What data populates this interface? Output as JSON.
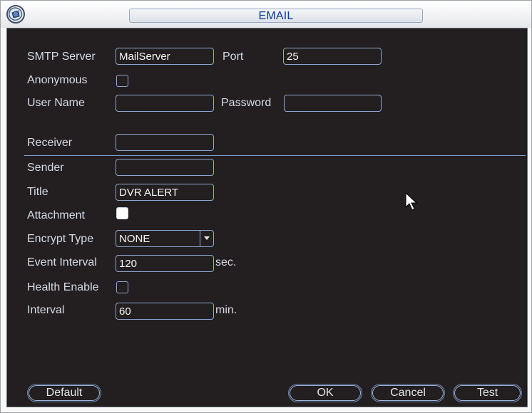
{
  "window": {
    "title": "EMAIL"
  },
  "form": {
    "smtp_server_label": "SMTP Server",
    "smtp_server_value": "MailServer",
    "port_label": "Port",
    "port_value": "25",
    "anonymous_label": "Anonymous",
    "anonymous_checked": false,
    "user_name_label": "User Name",
    "user_name_value": "",
    "password_label": "Password",
    "password_value": "",
    "receiver_label": "Receiver",
    "receiver_value": "",
    "sender_label": "Sender",
    "sender_value": "",
    "title_label": "Title",
    "title_value": "DVR ALERT",
    "attachment_label": "Attachment",
    "attachment_checked": true,
    "encrypt_type_label": "Encrypt Type",
    "encrypt_type_value": "NONE",
    "event_interval_label": "Event Interval",
    "event_interval_value": "120",
    "event_interval_unit": "sec.",
    "health_enable_label": "Health Enable",
    "health_enable_checked": false,
    "interval_label": "Interval",
    "interval_value": "60",
    "interval_unit": "min."
  },
  "buttons": {
    "default": "Default",
    "ok": "OK",
    "cancel": "Cancel",
    "test": "Test"
  },
  "icons": {
    "app_icon": "settings-icon",
    "cursor": "mouse-pointer-icon",
    "dropdown": "chevron-down-icon"
  }
}
